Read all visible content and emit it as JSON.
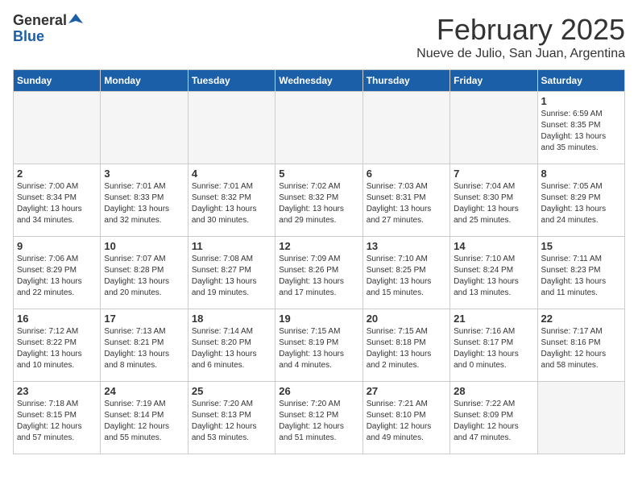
{
  "logo": {
    "general": "General",
    "blue": "Blue"
  },
  "title": "February 2025",
  "location": "Nueve de Julio, San Juan, Argentina",
  "days_of_week": [
    "Sunday",
    "Monday",
    "Tuesday",
    "Wednesday",
    "Thursday",
    "Friday",
    "Saturday"
  ],
  "weeks": [
    [
      {
        "day": "",
        "info": ""
      },
      {
        "day": "",
        "info": ""
      },
      {
        "day": "",
        "info": ""
      },
      {
        "day": "",
        "info": ""
      },
      {
        "day": "",
        "info": ""
      },
      {
        "day": "",
        "info": ""
      },
      {
        "day": "1",
        "info": "Sunrise: 6:59 AM\nSunset: 8:35 PM\nDaylight: 13 hours and 35 minutes."
      }
    ],
    [
      {
        "day": "2",
        "info": "Sunrise: 7:00 AM\nSunset: 8:34 PM\nDaylight: 13 hours and 34 minutes."
      },
      {
        "day": "3",
        "info": "Sunrise: 7:01 AM\nSunset: 8:33 PM\nDaylight: 13 hours and 32 minutes."
      },
      {
        "day": "4",
        "info": "Sunrise: 7:01 AM\nSunset: 8:32 PM\nDaylight: 13 hours and 30 minutes."
      },
      {
        "day": "5",
        "info": "Sunrise: 7:02 AM\nSunset: 8:32 PM\nDaylight: 13 hours and 29 minutes."
      },
      {
        "day": "6",
        "info": "Sunrise: 7:03 AM\nSunset: 8:31 PM\nDaylight: 13 hours and 27 minutes."
      },
      {
        "day": "7",
        "info": "Sunrise: 7:04 AM\nSunset: 8:30 PM\nDaylight: 13 hours and 25 minutes."
      },
      {
        "day": "8",
        "info": "Sunrise: 7:05 AM\nSunset: 8:29 PM\nDaylight: 13 hours and 24 minutes."
      }
    ],
    [
      {
        "day": "9",
        "info": "Sunrise: 7:06 AM\nSunset: 8:29 PM\nDaylight: 13 hours and 22 minutes."
      },
      {
        "day": "10",
        "info": "Sunrise: 7:07 AM\nSunset: 8:28 PM\nDaylight: 13 hours and 20 minutes."
      },
      {
        "day": "11",
        "info": "Sunrise: 7:08 AM\nSunset: 8:27 PM\nDaylight: 13 hours and 19 minutes."
      },
      {
        "day": "12",
        "info": "Sunrise: 7:09 AM\nSunset: 8:26 PM\nDaylight: 13 hours and 17 minutes."
      },
      {
        "day": "13",
        "info": "Sunrise: 7:10 AM\nSunset: 8:25 PM\nDaylight: 13 hours and 15 minutes."
      },
      {
        "day": "14",
        "info": "Sunrise: 7:10 AM\nSunset: 8:24 PM\nDaylight: 13 hours and 13 minutes."
      },
      {
        "day": "15",
        "info": "Sunrise: 7:11 AM\nSunset: 8:23 PM\nDaylight: 13 hours and 11 minutes."
      }
    ],
    [
      {
        "day": "16",
        "info": "Sunrise: 7:12 AM\nSunset: 8:22 PM\nDaylight: 13 hours and 10 minutes."
      },
      {
        "day": "17",
        "info": "Sunrise: 7:13 AM\nSunset: 8:21 PM\nDaylight: 13 hours and 8 minutes."
      },
      {
        "day": "18",
        "info": "Sunrise: 7:14 AM\nSunset: 8:20 PM\nDaylight: 13 hours and 6 minutes."
      },
      {
        "day": "19",
        "info": "Sunrise: 7:15 AM\nSunset: 8:19 PM\nDaylight: 13 hours and 4 minutes."
      },
      {
        "day": "20",
        "info": "Sunrise: 7:15 AM\nSunset: 8:18 PM\nDaylight: 13 hours and 2 minutes."
      },
      {
        "day": "21",
        "info": "Sunrise: 7:16 AM\nSunset: 8:17 PM\nDaylight: 13 hours and 0 minutes."
      },
      {
        "day": "22",
        "info": "Sunrise: 7:17 AM\nSunset: 8:16 PM\nDaylight: 12 hours and 58 minutes."
      }
    ],
    [
      {
        "day": "23",
        "info": "Sunrise: 7:18 AM\nSunset: 8:15 PM\nDaylight: 12 hours and 57 minutes."
      },
      {
        "day": "24",
        "info": "Sunrise: 7:19 AM\nSunset: 8:14 PM\nDaylight: 12 hours and 55 minutes."
      },
      {
        "day": "25",
        "info": "Sunrise: 7:20 AM\nSunset: 8:13 PM\nDaylight: 12 hours and 53 minutes."
      },
      {
        "day": "26",
        "info": "Sunrise: 7:20 AM\nSunset: 8:12 PM\nDaylight: 12 hours and 51 minutes."
      },
      {
        "day": "27",
        "info": "Sunrise: 7:21 AM\nSunset: 8:10 PM\nDaylight: 12 hours and 49 minutes."
      },
      {
        "day": "28",
        "info": "Sunrise: 7:22 AM\nSunset: 8:09 PM\nDaylight: 12 hours and 47 minutes."
      },
      {
        "day": "",
        "info": ""
      }
    ]
  ]
}
